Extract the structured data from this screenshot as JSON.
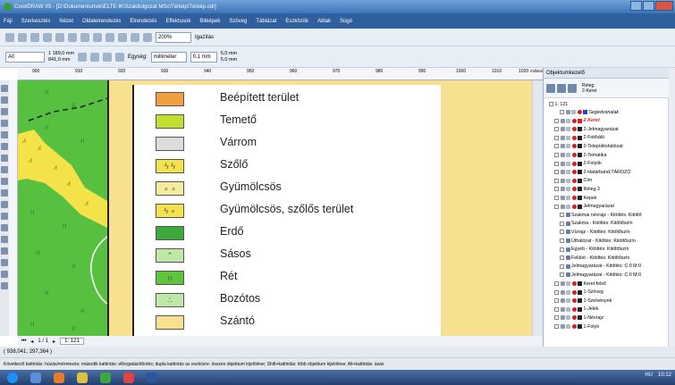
{
  "window": {
    "title": "CorelDRAW X5 - [D:\\Dokumentumok\\ELTE-IK\\Szakdolgozat MSc\\Térkép\\Térkép.cdr]"
  },
  "menu": [
    "Fájl",
    "Szerkesztés",
    "Nézet",
    "Oldalelrendezés",
    "Elrendezés",
    "Effektusok",
    "Bitképek",
    "Szöveg",
    "Táblázat",
    "Eszközök",
    "Ablak",
    "Súgó"
  ],
  "toolbar": {
    "zoom": "200%",
    "snap": "Igazítás"
  },
  "propbar": {
    "preset": "A0",
    "width": "1 189,0 mm",
    "height": "841,0 mm",
    "units_label": "Egység:",
    "units": "milliméter",
    "nudge": "0,1 mm",
    "dup_x": "5,0 mm",
    "dup_y": "5,0 mm"
  },
  "ruler": {
    "ticks": [
      "900",
      "910",
      "920",
      "930",
      "940",
      "950",
      "960",
      "970",
      "980",
      "990",
      "1000",
      "1010",
      "1020"
    ],
    "unit": "milliméter"
  },
  "legend": [
    {
      "label": "Beépített terület",
      "color": "#f0a040",
      "pattern": ""
    },
    {
      "label": "Temető",
      "color": "#c2df2f",
      "pattern": ""
    },
    {
      "label": "Várrom",
      "color": "#dcdcdc",
      "pattern": ""
    },
    {
      "label": "Szőlő",
      "color": "#f4e24a",
      "pattern": "ϟ ϟ"
    },
    {
      "label": "Gyümölcsös",
      "color": "#f4eda0",
      "pattern": "∘ ∘"
    },
    {
      "label": "Gyümölcsös, szőlős terület",
      "color": "#f4e24a",
      "pattern": "ϟ ∘"
    },
    {
      "label": "Erdő",
      "color": "#3eaa3e",
      "pattern": ""
    },
    {
      "label": "Sásos",
      "color": "#bfe8a6",
      "pattern": "⌃"
    },
    {
      "label": "Rét",
      "color": "#5ec43a",
      "pattern": "ıı"
    },
    {
      "label": "Bozótos",
      "color": "#bfe8a6",
      "pattern": "∴"
    },
    {
      "label": "Szántó",
      "color": "#f7e08f",
      "pattern": ""
    }
  ],
  "pagebar": {
    "pages": "1 / 1",
    "tab": "1: 121"
  },
  "status": {
    "coords": "( 938,041; 297,364 )",
    "hint": "Következő kattintás: húzás/méretezés; második kattintás: elforgatás/döntés; dupla kattintás az eszközre: összes objektum kijelölése; Shift+kattintás: több objektum kijelölése; Alt+kattintás: ásás"
  },
  "object_manager": {
    "title": "Objektumkezelő",
    "layer_label": "Réteg:",
    "layer_value": "2-Keret",
    "page": "1: 121",
    "items": [
      {
        "label": "Segédvonalak",
        "color": "#2f3fd0",
        "level": 2
      },
      {
        "label": "2-Keret",
        "color": "#e02020",
        "level": 1
      },
      {
        "label": "2-Jelmagyarázat",
        "color": "#222",
        "level": 1
      },
      {
        "label": "2-Fokháló",
        "color": "#222",
        "level": 1
      },
      {
        "label": "2-Településhálózat",
        "color": "#222",
        "level": 1
      },
      {
        "label": "2-Tematika",
        "color": "#222",
        "level": 1
      },
      {
        "label": "2-Folyók",
        "color": "#222",
        "level": 1
      },
      {
        "label": "2-Határband,TÁROZÓ",
        "color": "#222",
        "level": 1
      },
      {
        "label": "Cím",
        "color": "#222",
        "level": 1
      },
      {
        "label": "Réteg 2",
        "color": "#222",
        "level": 1
      },
      {
        "label": "Képek",
        "color": "#222",
        "level": 1
      },
      {
        "label": "Jelmagyarázat",
        "color": "#222",
        "level": 1
      },
      {
        "label": "Szakmai névrajz - Kitöltés: Kitöltő",
        "color": "",
        "level": 2
      },
      {
        "label": "Szakma - Kitöltés: Kitöltőszín",
        "color": "",
        "level": 2
      },
      {
        "label": "Vízrajz - Kitöltés: Kitöltőszín",
        "color": "",
        "level": 2
      },
      {
        "label": "Úthálózat - Kitöltés: Kitöltőszín",
        "color": "",
        "level": 2
      },
      {
        "label": "Egyéb - Kitöltés: Kitöltőszín",
        "color": "",
        "level": 2
      },
      {
        "label": "Felület - Kitöltés: Kitöltőszín",
        "color": "",
        "level": 2
      },
      {
        "label": "Jelmagyarázat - Kitöltés: C:0 M:0",
        "color": "",
        "level": 2
      },
      {
        "label": "Jelmagyarázat - Kitöltés: C:0 M:0",
        "color": "",
        "level": 2
      },
      {
        "label": "Keret felső",
        "color": "#222",
        "level": 1
      },
      {
        "label": "1-Szöveg",
        "color": "#222",
        "level": 1
      },
      {
        "label": "1-Szelvények",
        "color": "#222",
        "level": 1
      },
      {
        "label": "1-Jelek",
        "color": "#222",
        "level": 1
      },
      {
        "label": "1-Névrajz",
        "color": "#222",
        "level": 1
      },
      {
        "label": "1-Folyó",
        "color": "#222",
        "level": 1
      }
    ]
  },
  "taskbar": {
    "lang": "HU",
    "time": "10:12"
  }
}
